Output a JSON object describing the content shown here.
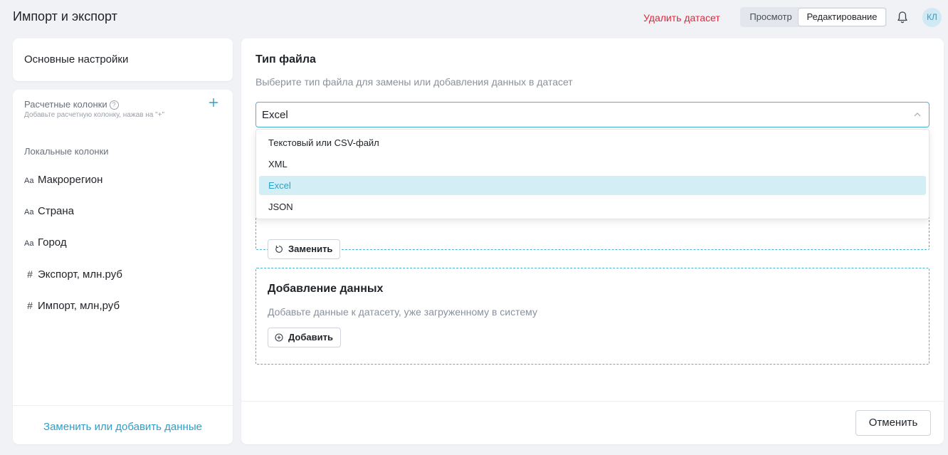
{
  "header": {
    "title": "Импорт и экспорт",
    "delete_label": "Удалить датасет",
    "modes": {
      "view": "Просмотр",
      "edit": "Редактирование",
      "active": "edit"
    },
    "avatar_initials": "КЛ",
    "accent_color": "#2f9fc6",
    "danger_color": "#e5243b"
  },
  "sidebar": {
    "main_settings_label": "Основные настройки",
    "calc_columns_title": "Расчетные колонки",
    "calc_columns_hint": "Добавьте расчетную колонку, нажав на \"+\"",
    "local_columns_title": "Локальные колонки",
    "columns": [
      {
        "type_glyph": "Aa",
        "label": "Макрорегион"
      },
      {
        "type_glyph": "Aa",
        "label": "Страна"
      },
      {
        "type_glyph": "Aa",
        "label": "Город"
      },
      {
        "type_glyph": "#",
        "label": "Экспорт, млн.руб"
      },
      {
        "type_glyph": "#",
        "label": "Импорт, млн,руб"
      }
    ],
    "replace_or_add_label": "Заменить или добавить данные"
  },
  "main": {
    "file_type_title": "Тип файла",
    "file_type_desc": "Выберите тип файла для замены или добавления данных в датасет",
    "select_value": "Excel",
    "options": [
      "Текстовый или CSV-файл",
      "XML",
      "Excel",
      "JSON"
    ],
    "selected_option": "Excel",
    "replace_button": "Заменить",
    "add_section_title": "Добавление данных",
    "add_section_desc": "Добавьте данные к датасету, уже загруженному в систему",
    "add_button": "Добавить",
    "cancel_button": "Отменить"
  }
}
